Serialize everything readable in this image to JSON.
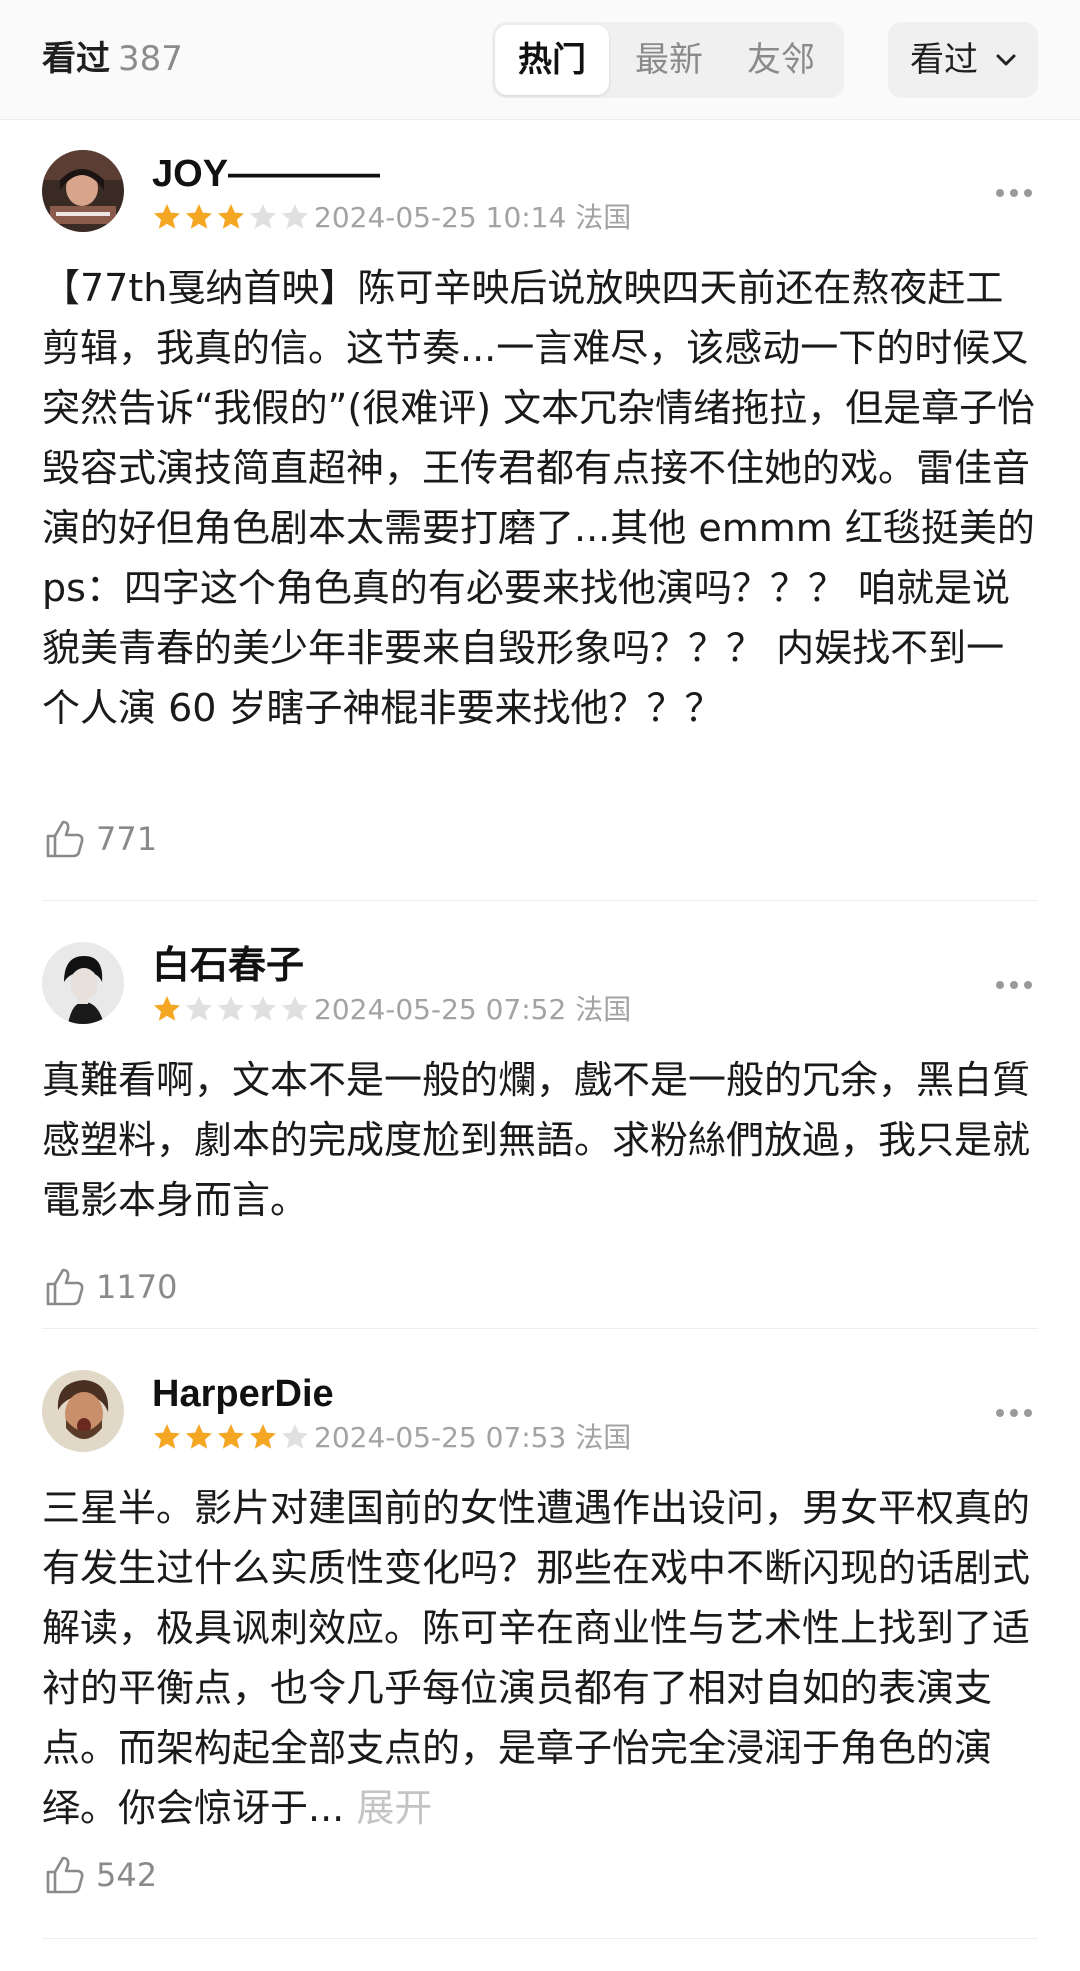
{
  "header": {
    "seen_label": "看过",
    "seen_count": "387",
    "tabs": [
      "热门",
      "最新",
      "友邻"
    ],
    "active_tab": "热门",
    "filter_label": "看过"
  },
  "colors": {
    "star_on": "#f5a623",
    "star_off": "#e0e0e0"
  },
  "reviews": [
    {
      "user": "JOY————",
      "rating": 3,
      "date": "2024-05-25 10:14",
      "location": "法国",
      "text": "【77th戛纳首映】陈可辛映后说放映四天前还在熬夜赶工剪辑，我真的信。这节奏...一言难尽，该感动一下的时候又突然告诉“我假的”(很难评) 文本冗杂情绪拖拉，但是章子怡毁容式演技简直超神，王传君都有点接不住她的戏。雷佳音演的好但角色剧本太需要打磨了...其他 emmm 红毯挺美的 ps：四字这个角色真的有必要来找他演吗？？？ 咱就是说貌美青春的美少年非要来自毁形象吗？？？ 内娱找不到一个人演 60 岁瞎子神棍非要来找他？？？",
      "likes": "771"
    },
    {
      "user": "白石春子",
      "rating": 1,
      "date": "2024-05-25 07:52",
      "location": "法国",
      "text": "真難看啊，文本不是一般的爛，戲不是一般的冗余，黑白質感塑料，劇本的完成度尬到無語。求粉絲們放過，我只是就電影本身而言。",
      "likes": "1170"
    },
    {
      "user": "HarperDie",
      "rating": 4,
      "date": "2024-05-25 07:53",
      "location": "法国",
      "text": "三星半。影片对建国前的女性遭遇作出设问，男女平权真的有发生过什么实质性变化吗？那些在戏中不断闪现的话剧式解读，极具讽刺效应。陈可辛在商业性与艺术性上找到了适衬的平衡点，也令几乎每位演员都有了相对自如的表演支点。而架构起全部支点的，是章子怡完全浸润于角色的演绎。你会惊讶于...",
      "expand_label": "展开",
      "likes": "542"
    }
  ]
}
